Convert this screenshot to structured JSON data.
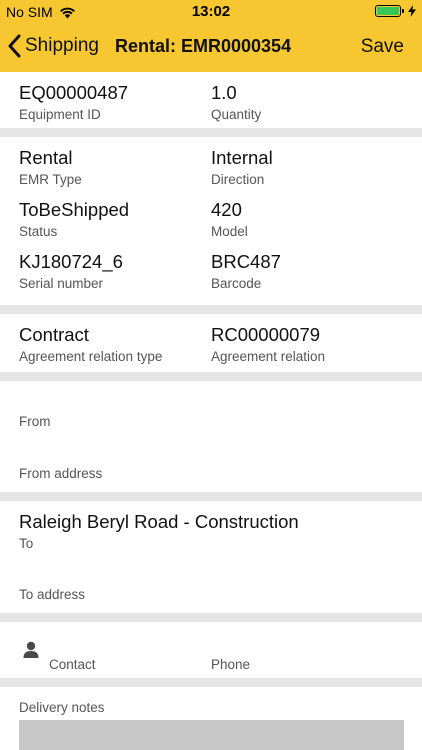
{
  "status_bar": {
    "carrier": "No SIM",
    "time": "13:02",
    "battery_level": 1.0,
    "colors": {
      "bar": "#f6c730",
      "battery": "#35c759"
    }
  },
  "nav": {
    "back_label": "Shipping",
    "title": "Rental: EMR0000354",
    "save_label": "Save"
  },
  "equipment": {
    "equipment_id": {
      "value": "EQ00000487",
      "label": "Equipment ID"
    },
    "quantity": {
      "value": "1.0",
      "label": "Quantity"
    }
  },
  "details": {
    "emr_type": {
      "value": "Rental",
      "label": "EMR Type"
    },
    "direction": {
      "value": "Internal",
      "label": "Direction"
    },
    "status": {
      "value": "ToBeShipped",
      "label": "Status"
    },
    "model": {
      "value": "420",
      "label": "Model"
    },
    "serial": {
      "value": "KJ180724_6",
      "label": "Serial number"
    },
    "barcode": {
      "value": "BRC487",
      "label": "Barcode"
    }
  },
  "agreement": {
    "relation_type": {
      "value": "Contract",
      "label": "Agreement relation type"
    },
    "relation": {
      "value": "RC00000079",
      "label": "Agreement relation"
    }
  },
  "from": {
    "from_label": "From",
    "from_address_label": "From address"
  },
  "to": {
    "to_value": "Raleigh Beryl Road - Construction",
    "to_label": "To",
    "to_address_label": "To address"
  },
  "contact": {
    "contact_label": "Contact",
    "phone_label": "Phone",
    "icon": "person-icon"
  },
  "notes": {
    "label": "Delivery notes"
  }
}
